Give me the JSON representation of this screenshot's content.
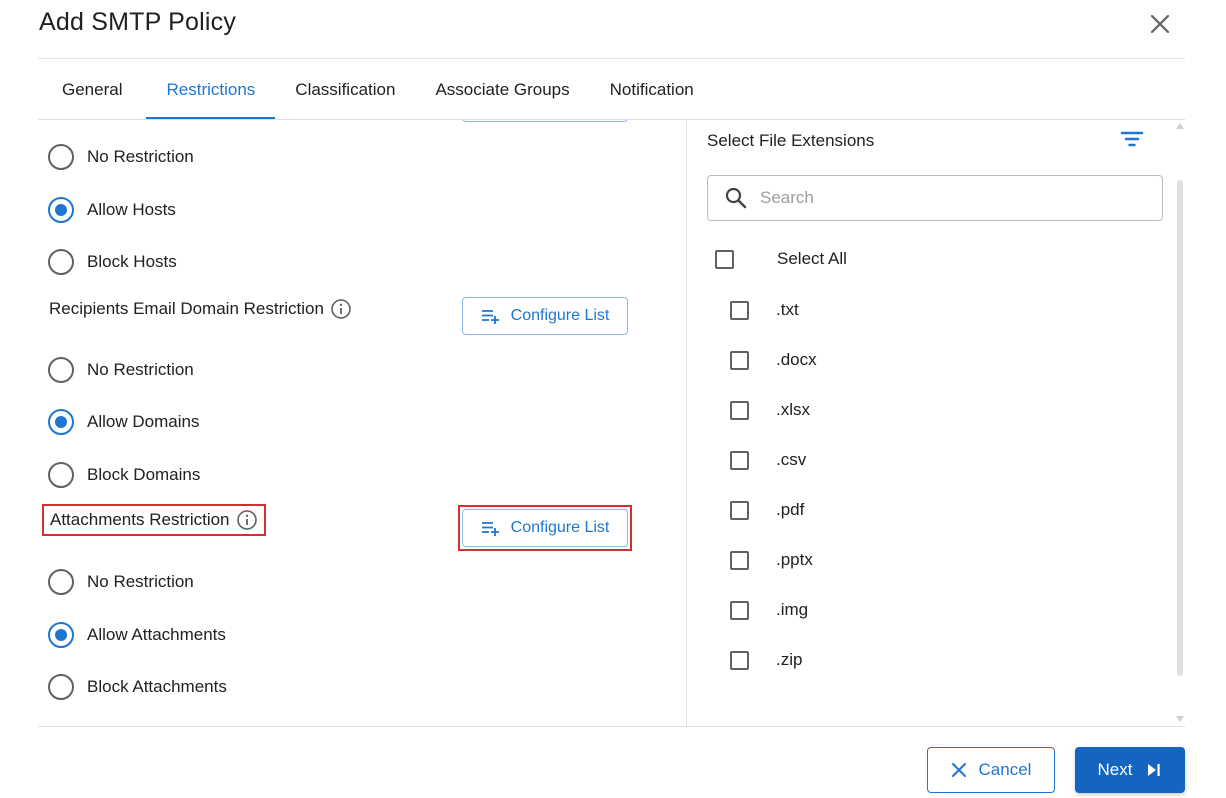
{
  "dialog": {
    "title": "Add SMTP Policy"
  },
  "tabs": [
    {
      "label": "General",
      "active": false
    },
    {
      "label": "Restrictions",
      "active": true
    },
    {
      "label": "Classification",
      "active": false
    },
    {
      "label": "Associate Groups",
      "active": false
    },
    {
      "label": "Notification",
      "active": false
    }
  ],
  "hosts": {
    "options": [
      {
        "label": "No Restriction",
        "checked": false
      },
      {
        "label": "Allow Hosts",
        "checked": true
      },
      {
        "label": "Block Hosts",
        "checked": false
      }
    ]
  },
  "domains": {
    "title": "Recipients Email Domain Restriction",
    "configure_label": "Configure List",
    "options": [
      {
        "label": "No Restriction",
        "checked": false
      },
      {
        "label": "Allow Domains",
        "checked": true
      },
      {
        "label": "Block Domains",
        "checked": false
      }
    ]
  },
  "attachments": {
    "title": "Attachments Restriction",
    "configure_label": "Configure List",
    "options": [
      {
        "label": "No Restriction",
        "checked": false
      },
      {
        "label": "Allow Attachments",
        "checked": true
      },
      {
        "label": "Block Attachments",
        "checked": false
      }
    ]
  },
  "file_extensions": {
    "title": "Select File Extensions",
    "search_placeholder": "Search",
    "select_all_label": "Select All",
    "items": [
      ".txt",
      ".docx",
      ".xlsx",
      ".csv",
      ".pdf",
      ".pptx",
      ".img",
      ".zip"
    ]
  },
  "footer": {
    "cancel_label": "Cancel",
    "next_label": "Next"
  },
  "colors": {
    "accent": "#1e76d2",
    "primary_button": "#1565c0",
    "highlight": "#d32f2f"
  }
}
